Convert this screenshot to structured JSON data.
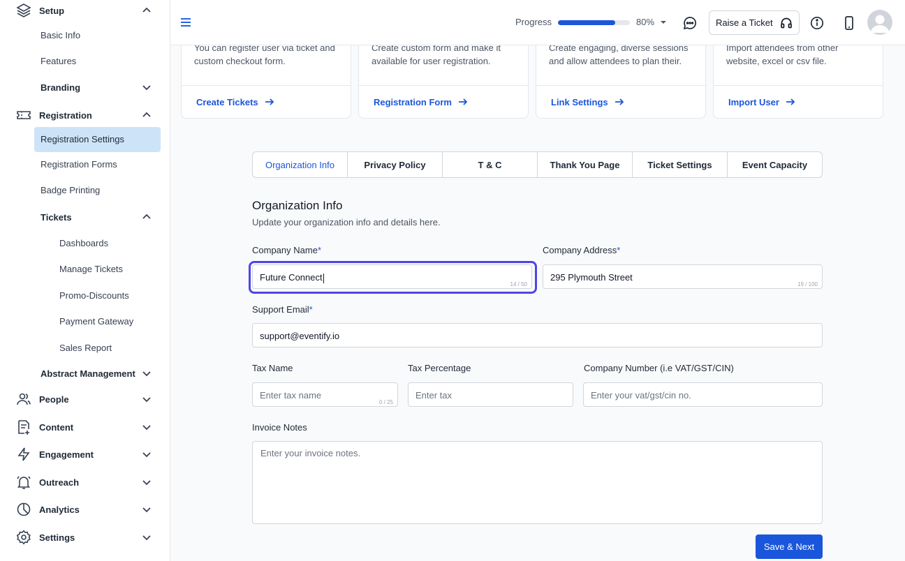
{
  "sidebar": {
    "setup": {
      "label": "Setup",
      "icon": "layers-icon"
    },
    "setup_items": [
      "Basic Info",
      "Features",
      "Branding"
    ],
    "registration": {
      "label": "Registration",
      "icon": "ticket-icon"
    },
    "registration_items": {
      "active": "Registration Settings",
      "forms": "Registration Forms",
      "badge": "Badge Printing",
      "tickets": "Tickets"
    },
    "ticket_items": [
      "Dashboards",
      "Manage Tickets",
      "Promo-Discounts",
      "Payment Gateway",
      "Sales Report"
    ],
    "abstract": "Abstract Management",
    "sections": [
      {
        "label": "People",
        "icon": "users-icon"
      },
      {
        "label": "Content",
        "icon": "document-plus-icon"
      },
      {
        "label": "Engagement",
        "icon": "lightning-icon"
      },
      {
        "label": "Outreach",
        "icon": "bell-icon"
      },
      {
        "label": "Analytics",
        "icon": "pie-chart-icon"
      },
      {
        "label": "Settings",
        "icon": "gear-icon"
      }
    ]
  },
  "header": {
    "progress_label": "Progress",
    "progress_value": 0.8,
    "progress_pct": "80%",
    "raise_ticket": "Raise a Ticket"
  },
  "cards": [
    {
      "desc": "You can register user via ticket and custom checkout form.",
      "link": "Create Tickets"
    },
    {
      "desc": "Create custom form and make it available for user registration.",
      "link": "Registration Form"
    },
    {
      "desc": "Create engaging, diverse sessions and allow attendees to plan their.",
      "link": "Link Settings"
    },
    {
      "desc": "Import attendees from other website, excel or csv file.",
      "link": "Import User"
    }
  ],
  "tabs": [
    "Organization Info",
    "Privacy Policy",
    "T & C",
    "Thank You Page",
    "Ticket Settings",
    "Event Capacity"
  ],
  "form": {
    "title": "Organization Info",
    "subtitle": "Update your organization info and details here.",
    "company_name": {
      "label": "Company Name",
      "value": "Future Connect",
      "count": "14 / 50"
    },
    "company_address": {
      "label": "Company Address",
      "value": "295 Plymouth Street",
      "count": "19 / 100"
    },
    "support_email": {
      "label": "Support Email",
      "value": "support@eventify.io"
    },
    "tax_name": {
      "label": "Tax Name",
      "placeholder": "Enter tax name",
      "count": "0 / 25"
    },
    "tax_percentage": {
      "label": "Tax Percentage",
      "placeholder": "Enter tax"
    },
    "company_number": {
      "label": "Company Number (i.e VAT/GST/CIN)",
      "placeholder": "Enter your vat/gst/cin no."
    },
    "invoice_notes": {
      "label": "Invoice Notes",
      "placeholder": "Enter your invoice notes."
    },
    "required_mark": "*",
    "save_label": "Save & Next"
  },
  "colors": {
    "accent": "#1a56db",
    "active_bg": "#cde4f8",
    "focus": "#4f46e5"
  }
}
